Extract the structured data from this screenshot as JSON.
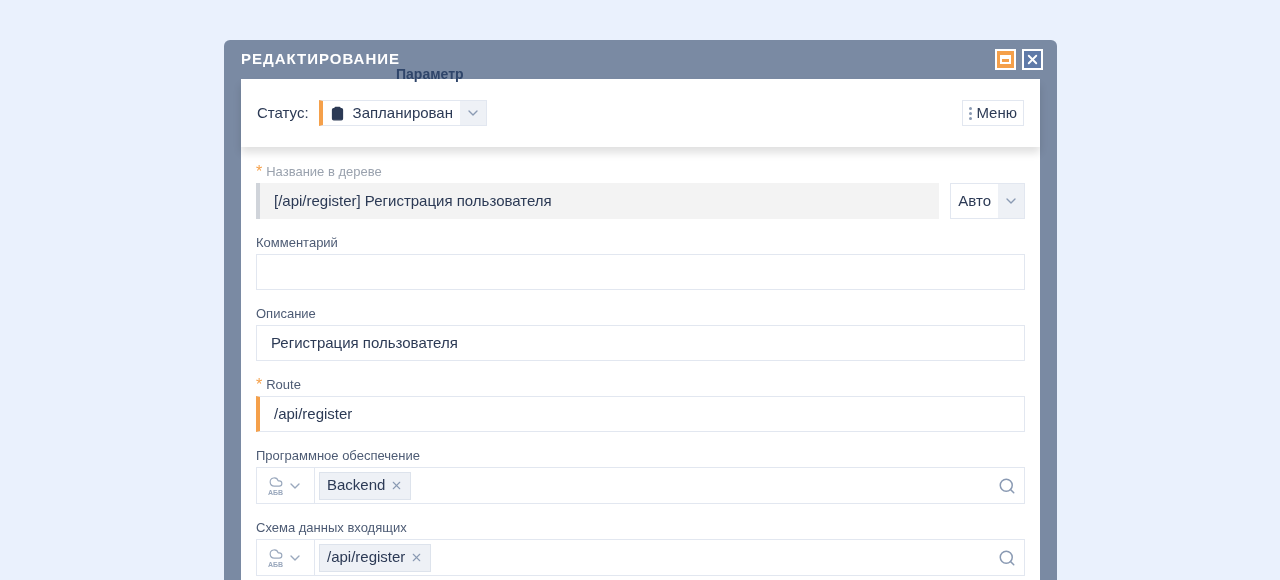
{
  "backdrop": {
    "column_heading": "Параметр"
  },
  "dialog": {
    "title": "РЕДАКТИРОВАНИЕ"
  },
  "status": {
    "label": "Статус:",
    "value": "Запланирован"
  },
  "menu_button": {
    "label": "Меню"
  },
  "fields": [
    {
      "kind": "text",
      "label": "Название в дереве",
      "required": true,
      "required_mark": "*",
      "readonly": true,
      "value": "[/api/register] Регистрация пользователя",
      "suffix": "Авто"
    },
    {
      "kind": "text",
      "label": "Комментарий",
      "required": false,
      "readonly": false
    },
    {
      "kind": "text",
      "label": "Описание",
      "required": false,
      "readonly": false,
      "value": "Регистрация пользователя"
    },
    {
      "kind": "text",
      "label": "Route",
      "required": true,
      "required_mark": "*",
      "readonly": false,
      "value": "/api/register"
    },
    {
      "kind": "tags",
      "label": "Программное обеспечение",
      "mode": "АБВ",
      "tags": [
        "Backend"
      ]
    },
    {
      "kind": "tags",
      "label": "Схема данных входящих",
      "mode": "АБВ",
      "tags": [
        "/api/register"
      ]
    }
  ]
}
